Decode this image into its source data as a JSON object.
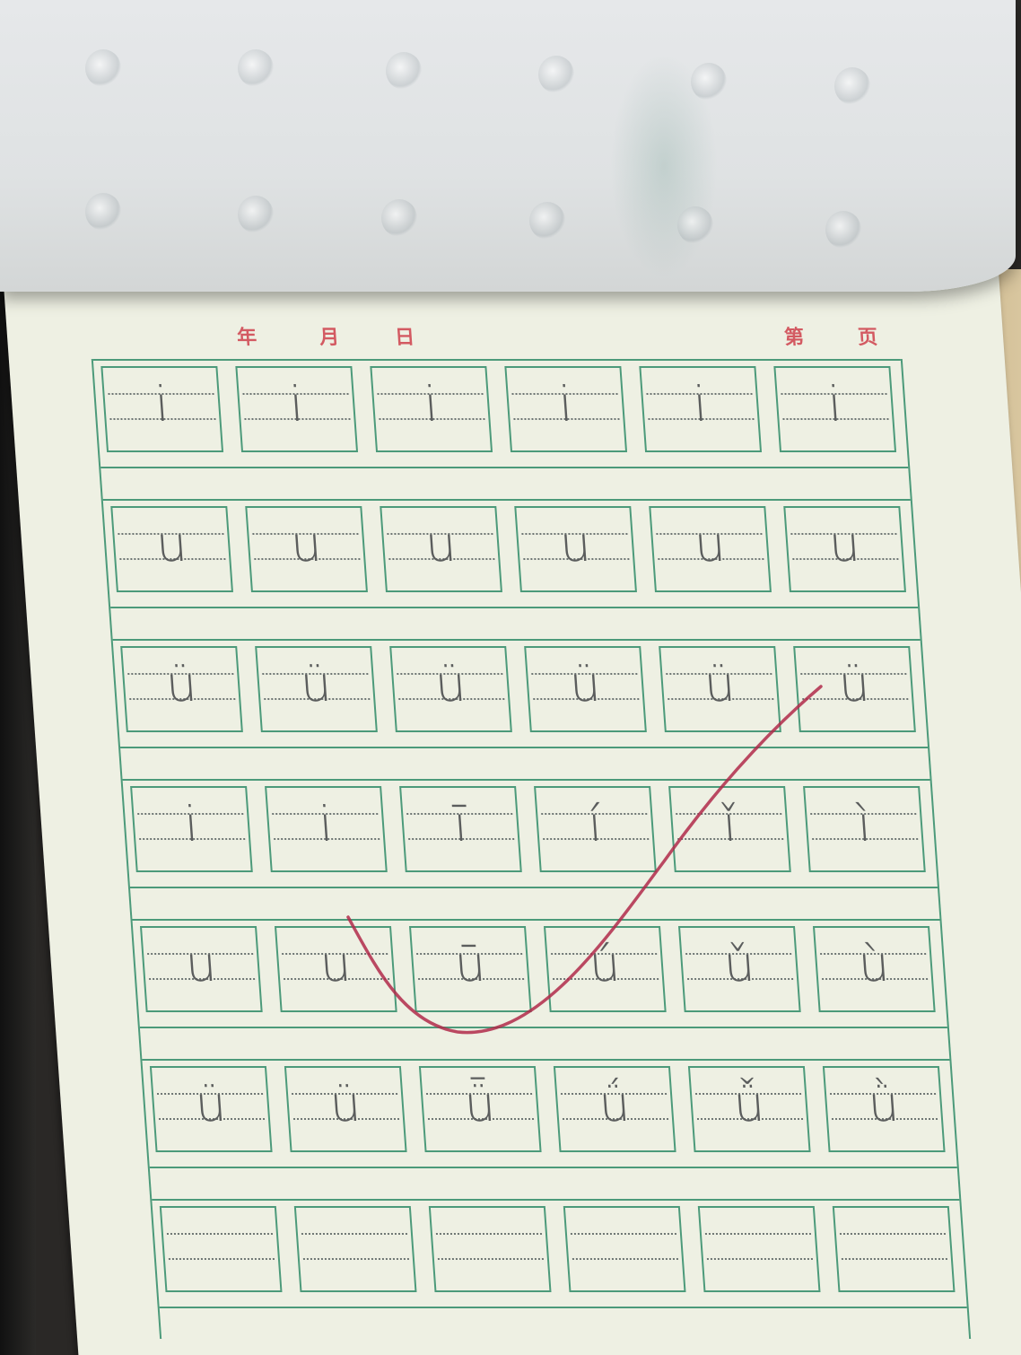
{
  "header": {
    "year": "年",
    "month": "月",
    "day": "日",
    "page_prefix": "第",
    "page_suffix": "页"
  },
  "rows": [
    [
      "i",
      "i",
      "i",
      "i",
      "i",
      "i"
    ],
    [
      "u",
      "u",
      "u",
      "u",
      "u",
      "u"
    ],
    [
      "ü",
      "ü",
      "ü",
      "ü",
      "ü",
      "ü"
    ],
    [
      "i",
      "i",
      "ī",
      "í",
      "ǐ",
      "ì"
    ],
    [
      "u",
      "u",
      "ū",
      "ú",
      "ǔ",
      "ù"
    ],
    [
      "ü",
      "ü",
      "ǖ",
      "ǘ",
      "ǚ",
      "ǜ"
    ],
    [
      "",
      "",
      "",
      "",
      "",
      ""
    ]
  ],
  "colors": {
    "grid": "#4c9a7a",
    "header_text": "#d35a62",
    "pencil": "#5b5d5d",
    "check_mark": "#b02a4a"
  }
}
